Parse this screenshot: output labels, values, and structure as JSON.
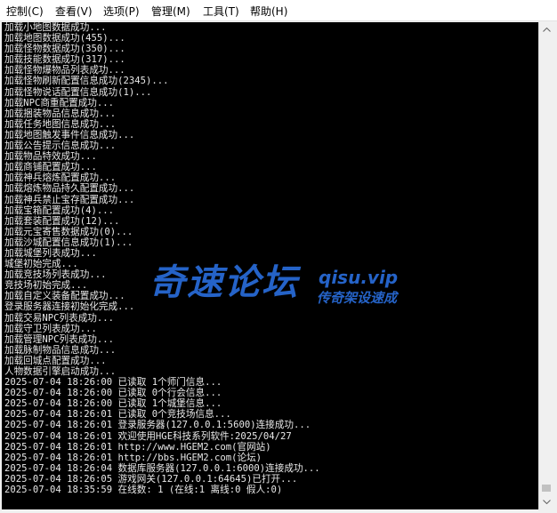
{
  "menu": {
    "items": [
      "控制(C)",
      "查看(V)",
      "选项(P)",
      "管理(M)",
      "工具(T)",
      "帮助(H)"
    ]
  },
  "console": {
    "lines": [
      "加载小地图数据成功...",
      "加载地图数据成功(455)...",
      "加载怪物数据成功(350)...",
      "加载技能数据成功(317)...",
      "加载怪物爆物品列表成功...",
      "加载怪物刷新配置信息成功(2345)...",
      "加载怪物说话配置信息成功(1)...",
      "加载NPC商重配置成功...",
      "加载捆装物品信息成功...",
      "加载任务地图信息成功...",
      "加载地图触发事件信息成功...",
      "加载公告提示信息成功...",
      "加载物品特效成功...",
      "加载商铺配置成功...",
      "加载神兵熔炼配置成功...",
      "加载熔炼物品持久配置成功...",
      "加载神兵禁止宝存配置成功...",
      "加载宝箱配置成功(4)...",
      "加载套装配置成功(12)...",
      "加载元宝寄售数据成功(0)...",
      "加载沙城配置信息成功(1)...",
      "加载城堡列表成功...",
      "城堡初始完成...",
      "加载竞技场列表成功...",
      "竞技场初始完成...",
      "加载自定义装备配置成功...",
      "登录服务器连接初始化完成...",
      "加载交易NPC列表成功...",
      "加载守卫列表成功...",
      "加载管理NPC列表成功...",
      "加载脉制物品信息成功...",
      "加载回城点配置成功...",
      "人物数据引擎启动成功...",
      "2025-07-04 18:26:00 已读取 1个师门信息...",
      "2025-07-04 18:26:00 已读取 0个行会信息...",
      "2025-07-04 18:26:00 已读取 1个城堡信息...",
      "2025-07-04 18:26:01 已读取 0个竞技场信息...",
      "2025-07-04 18:26:01 登录服务器(127.0.0.1:5600)连接成功...",
      "2025-07-04 18:26:01 欢迎使用HGE科技系列软件:2025/04/27",
      "2025-07-04 18:26:01 http://www.HGEM2.com(官网站)",
      "2025-07-04 18:26:01 http://bbs.HGEM2.com(论坛)",
      "2025-07-04 18:26:04 数据库服务器(127.0.0.1:6000)连接成功...",
      "2025-07-04 18:26:05 游戏网关(127.0.0.1:64645)已打开...",
      "2025-07-04 18:35:59 在线数: 1 (在线:1 离线:0 假人:0)"
    ]
  },
  "watermark": {
    "brand": "奇速论坛",
    "site": "qisu.vip",
    "tagline": "传奇架设速成"
  },
  "colors": {
    "console_bg": "#000000",
    "console_text": "#e8e8e8",
    "watermark": "#2563c8",
    "menubar_bg": "#ffffff"
  }
}
